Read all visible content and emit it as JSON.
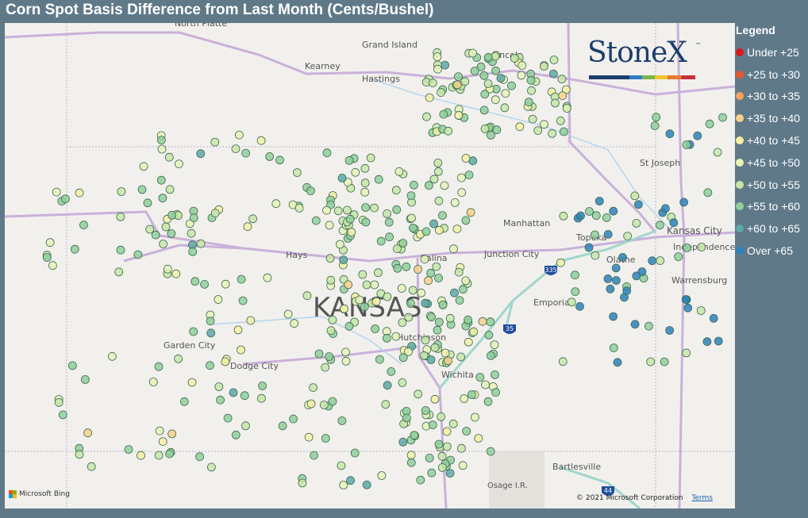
{
  "title": "Corn Spot Basis Difference from Last Month (Cents/Bushel)",
  "legend": {
    "title": "Legend",
    "items": [
      {
        "label": "Under +25",
        "color": "#d7191c"
      },
      {
        "label": "+25 to +30",
        "color": "#e8562a"
      },
      {
        "label": "+30 to +35",
        "color": "#f4a261"
      },
      {
        "label": "+35 to +40",
        "color": "#f9d08a"
      },
      {
        "label": "+40 to +45",
        "color": "#f6f0a5"
      },
      {
        "label": "+45 to +50",
        "color": "#e8f3b8"
      },
      {
        "label": "+50 to +55",
        "color": "#c8e6a8"
      },
      {
        "label": "+55 to +60",
        "color": "#8fcf9a"
      },
      {
        "label": "+60 to +65",
        "color": "#5ea8a8"
      },
      {
        "label": "Over +65",
        "color": "#2b83ba"
      }
    ]
  },
  "logo": {
    "text": "StoneX",
    "tm": "™"
  },
  "map_labels": {
    "state": "KANSAS",
    "cities": [
      "North Platte",
      "Grand Island",
      "Kearney",
      "Hastings",
      "Lincoln",
      "St Joseph",
      "Kansas City",
      "Independence",
      "Manhattan",
      "Topeka",
      "Olathe",
      "Junction City",
      "Salina",
      "Hays",
      "Emporia",
      "Warrensburg",
      "Hutchinson",
      "Garden City",
      "Dodge City",
      "Wichita",
      "Bartlesville",
      "Osage I.R."
    ],
    "shields": [
      "335",
      "35",
      "44"
    ]
  },
  "attribution": {
    "bing": "Microsoft Bing",
    "copyright": "© 2021 Microsoft Corporation",
    "terms": "Terms"
  }
}
